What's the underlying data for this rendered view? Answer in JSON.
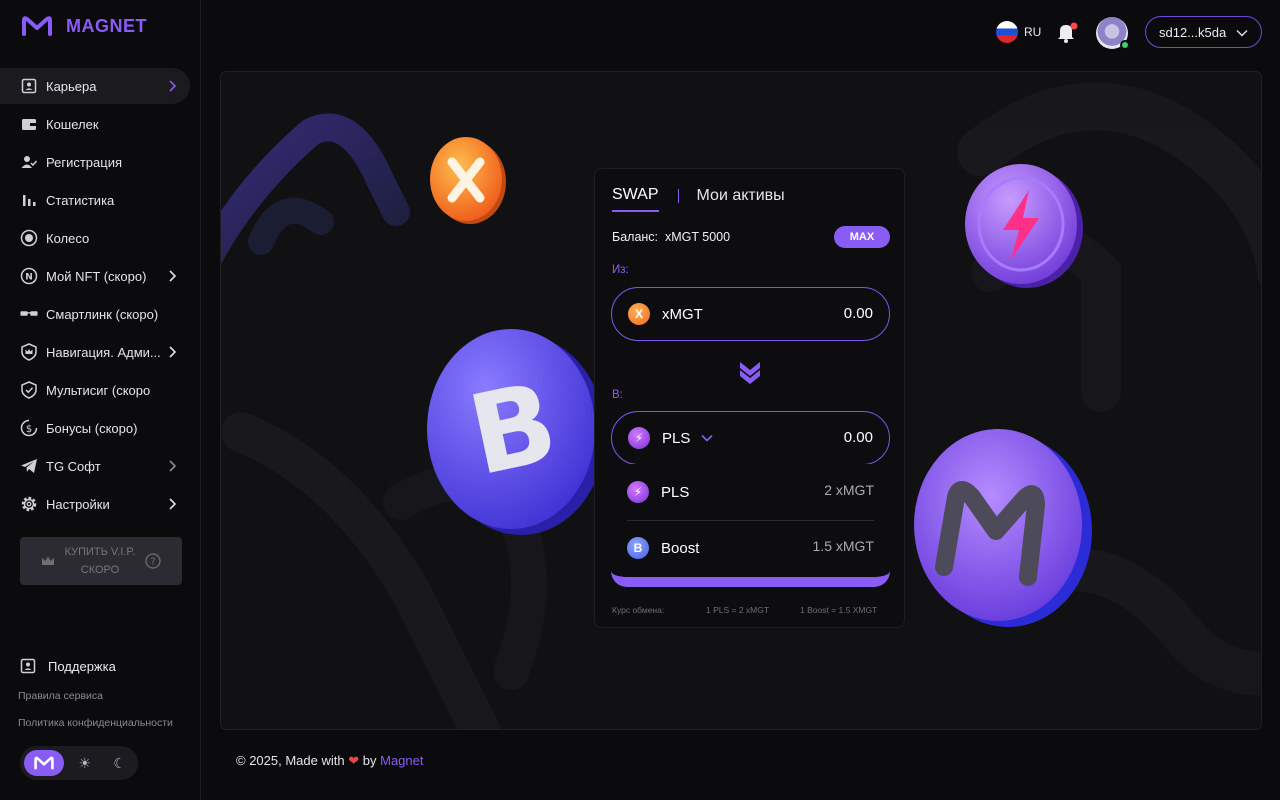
{
  "brand": {
    "name": "MAGNET",
    "accent": "#8a5cf6"
  },
  "sidebar": {
    "items": [
      {
        "label": "Карьера",
        "icon": "profile-card-icon",
        "chevron": true,
        "active": true
      },
      {
        "label": "Кошелек",
        "icon": "wallet-icon",
        "chevron": false
      },
      {
        "label": "Регистрация",
        "icon": "user-check-icon",
        "chevron": false
      },
      {
        "label": "Статистика",
        "icon": "bar-chart-icon",
        "chevron": false
      },
      {
        "label": "Колесо",
        "icon": "wheel-icon",
        "chevron": false
      },
      {
        "label": "Мой NFT (скоро)",
        "icon": "nft-icon",
        "chevron": true
      },
      {
        "label": "Смартлинк (скоро)",
        "icon": "glasses-icon",
        "chevron": false
      },
      {
        "label": "Навигация. Адми...",
        "icon": "crown-shield-icon",
        "chevron": true
      },
      {
        "label": "Мультисиг (скоро",
        "icon": "shield-check-icon",
        "chevron": false
      },
      {
        "label": "Бонусы (скоро)",
        "icon": "dollar-icon",
        "chevron": false
      },
      {
        "label": "TG Софт",
        "icon": "telegram-icon",
        "chevron": true
      },
      {
        "label": "Настройки",
        "icon": "gear-icon",
        "chevron": true
      }
    ],
    "vip_line1": "КУПИТЬ V.I.P.",
    "vip_line2": "СКОРО",
    "support": "Поддержка",
    "rules": "Правила сервиса",
    "privacy": "Политика конфиденциальности"
  },
  "header": {
    "lang": "RU",
    "wallet_address": "sd12...k5da"
  },
  "swap": {
    "tab_swap": "SWAP",
    "tab_assets": "Мои активы",
    "balance_label": "Баланс:",
    "balance_value": "xMGT 5000",
    "max_label": "MAX",
    "from_label": "Из:",
    "from_token": "xMGT",
    "from_amount": "0.00",
    "to_label": "В:",
    "to_token": "PLS",
    "to_amount": "0.00",
    "options": [
      {
        "token": "PLS",
        "price": "2 xMGT"
      },
      {
        "token": "Boost",
        "price": "1.5 xMGT"
      }
    ],
    "rate_label": "Курс обмена:",
    "rate_pls": "1 PLS = 2 xMGT",
    "rate_boost": "1 Boost = 1.5 XMGT"
  },
  "footer": {
    "prefix": "© 2025, Made with",
    "by": "by",
    "brand": "Magnet"
  }
}
